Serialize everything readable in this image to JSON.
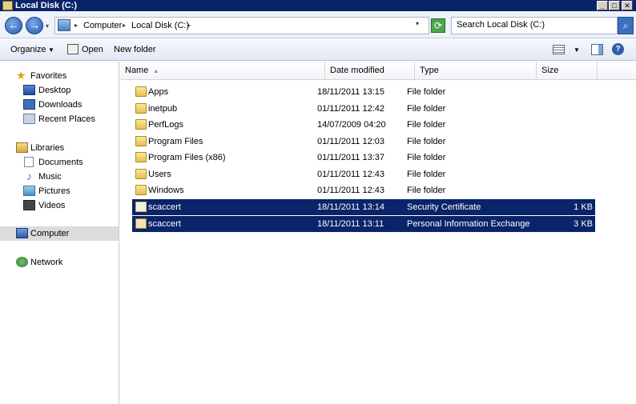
{
  "window": {
    "title": "Local Disk (C:)",
    "min_glyph": "_",
    "max_glyph": "□",
    "close_glyph": "✕"
  },
  "address": {
    "back_glyph": "←",
    "forward_glyph": "→",
    "recent_glyph": "▾",
    "crumbs": [
      "Computer",
      "Local Disk (C:)"
    ],
    "sep_glyph": "▸",
    "dropdown_glyph": "▾",
    "refresh_glyph": "⟳",
    "search_placeholder": "Search Local Disk (C:)",
    "search_glyph": "⌕"
  },
  "toolbar": {
    "organize_label": "Organize",
    "arrow_glyph": "▼",
    "open_label": "Open",
    "new_folder_label": "New folder",
    "help_glyph": "?"
  },
  "nav": {
    "favorites_label": "Favorites",
    "desktop_label": "Desktop",
    "downloads_label": "Downloads",
    "recent_label": "Recent Places",
    "libraries_label": "Libraries",
    "documents_label": "Documents",
    "music_label": "Music",
    "pictures_label": "Pictures",
    "videos_label": "Videos",
    "computer_label": "Computer",
    "network_label": "Network",
    "star_glyph": "★",
    "music_glyph": "♪"
  },
  "columns": {
    "name": "Name",
    "date": "Date modified",
    "type": "Type",
    "size": "Size",
    "sort_glyph": "▲"
  },
  "files": [
    {
      "name": "Apps",
      "date": "18/11/2011 13:15",
      "type": "File folder",
      "size": ""
    },
    {
      "name": "inetpub",
      "date": "01/11/2011 12:42",
      "type": "File folder",
      "size": ""
    },
    {
      "name": "PerfLogs",
      "date": "14/07/2009 04:20",
      "type": "File folder",
      "size": ""
    },
    {
      "name": "Program Files",
      "date": "01/11/2011 12:03",
      "type": "File folder",
      "size": ""
    },
    {
      "name": "Program Files (x86)",
      "date": "01/11/2011 13:37",
      "type": "File folder",
      "size": ""
    },
    {
      "name": "Users",
      "date": "01/11/2011 12:43",
      "type": "File folder",
      "size": ""
    },
    {
      "name": "Windows",
      "date": "01/11/2011 12:43",
      "type": "File folder",
      "size": ""
    },
    {
      "name": "scaccert",
      "date": "18/11/2011 13:14",
      "type": "Security Certificate",
      "size": "1 KB"
    },
    {
      "name": "scaccert",
      "date": "18/11/2011 13:11",
      "type": "Personal Information Exchange",
      "size": "3 KB"
    }
  ],
  "colors": {
    "selection": "#0a246a",
    "titlebar": "#0a246a"
  }
}
